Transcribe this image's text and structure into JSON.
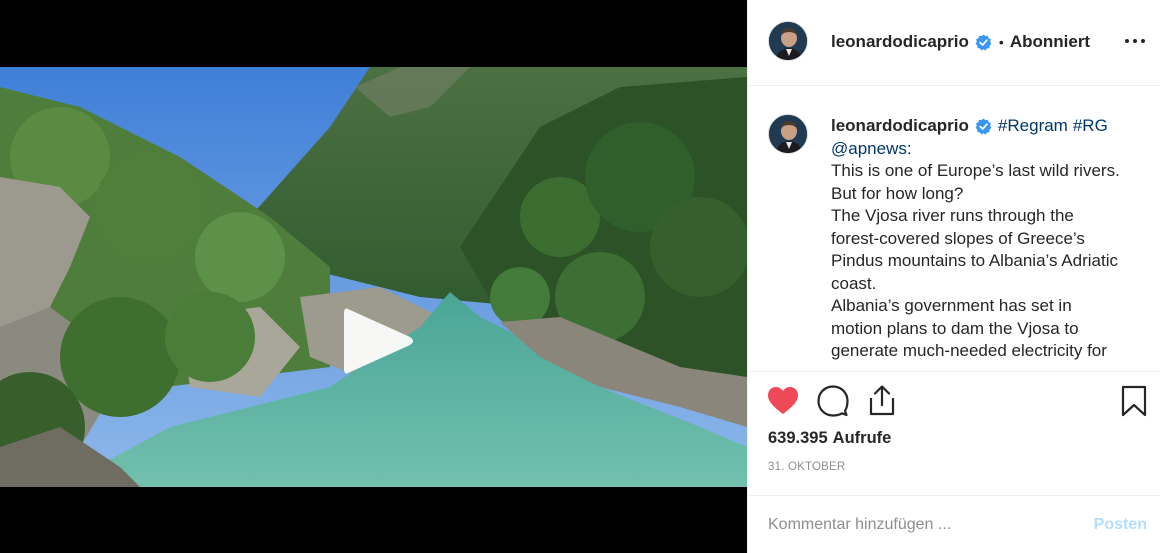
{
  "post": {
    "author": "leonardodicaprio",
    "follow_status": "Abonniert",
    "separator": "•",
    "more_label": "Mehr Optionen"
  },
  "caption": {
    "author": "leonardodicaprio",
    "tags": [
      "#Regram",
      "#RG"
    ],
    "lines": [
      "@apnews:",
      "This is one of Europe’s last wild rivers.",
      "But for how long?",
      "The Vjosa river runs through the",
      "forest-covered slopes of Greece’s",
      "Pindus mountains to Albania’s Adriatic",
      "coast.",
      "Albania’s government has set in",
      "motion plans to dam the Vjosa to",
      "generate much-needed electricity for"
    ]
  },
  "stats": {
    "views_count": "639.395",
    "views_label": "Aufrufe",
    "date": "31. OKTOBER"
  },
  "comment_box": {
    "placeholder": "Kommentar hinzufügen ...",
    "post_label": "Posten"
  },
  "icons": {
    "like": "heart-icon",
    "comment": "speech-bubble-icon",
    "share": "share-icon",
    "save": "bookmark-icon",
    "verified": "verified-badge-icon",
    "play": "play-icon"
  },
  "colors": {
    "like_active": "#ed4956",
    "verified": "#3897f0",
    "link": "#00376b",
    "post_button_disabled": "#b2dffc",
    "secondary_text": "#8e8e8e"
  }
}
